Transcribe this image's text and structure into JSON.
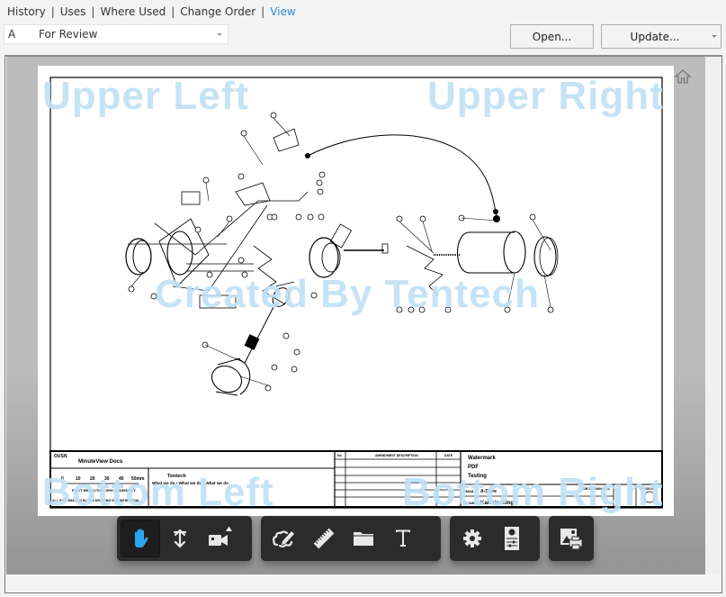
{
  "nav": {
    "links": [
      {
        "label": "History",
        "active": false
      },
      {
        "label": "Uses",
        "active": false
      },
      {
        "label": "Where Used",
        "active": false
      },
      {
        "label": "Change Order",
        "active": false
      },
      {
        "label": "View",
        "active": true
      }
    ],
    "separator": "|"
  },
  "revision_select": {
    "revision": "A",
    "state": "For Review"
  },
  "buttons": {
    "open": "Open...",
    "update": "Update..."
  },
  "viewer": {
    "watermarks": {
      "upper_left": "Upper Left",
      "upper_right": "Upper Right",
      "center": "Created By Tentech",
      "bottom_left": "Bottom Left",
      "bottom_right": "Bottom Right"
    },
    "title_block": {
      "corner_label": "OUSN",
      "company": "MinuteView Docs",
      "scale_ticks": [
        "0",
        "10",
        "20",
        "30",
        "40",
        "50mm"
      ],
      "scale_caption": "FIRST REDUCTION SPH | ASSEMBLY",
      "disclaimer": "ALL INFORMATION IN THIS DRAWING IS CONFIDENTIAL",
      "legend_title": "Tentech",
      "legend_sub": "What we do • What we do • What we do",
      "revision_header_no": "No.",
      "revision_header_desc": "AMENDMENT DESCRIPTION",
      "revision_header_date": "DATE",
      "title_lines": [
        "Watermark",
        "PDF",
        "Testing"
      ],
      "email_label": "EMAIL",
      "email_value": "A-Store",
      "drawn_label": "DRAWN",
      "drawn_value": "Karl Hosking",
      "job_label": "JOB DRAWING No.",
      "rev_label": "REVISION"
    }
  },
  "toolbar": {
    "accent_color": "#29a8f0",
    "groups": [
      [
        {
          "icon": "hand-pan-icon",
          "label": "Pan",
          "active": true
        },
        {
          "icon": "vertical-arrows-icon",
          "label": "Zoom",
          "active": false
        },
        {
          "icon": "video-camera-icon",
          "label": "Camera",
          "active": false
        }
      ],
      [
        {
          "icon": "markup-cloud-icon",
          "label": "Markup",
          "active": false
        },
        {
          "icon": "ruler-icon",
          "label": "Measure",
          "active": false
        },
        {
          "icon": "folder-icon",
          "label": "Open",
          "active": false
        },
        {
          "icon": "text-icon",
          "label": "Text",
          "active": false
        }
      ],
      [
        {
          "icon": "gear-icon",
          "label": "Settings",
          "active": false
        },
        {
          "icon": "properties-icon",
          "label": "Properties",
          "active": false
        }
      ],
      [
        {
          "icon": "print-icon",
          "label": "Print",
          "active": false
        }
      ]
    ]
  }
}
